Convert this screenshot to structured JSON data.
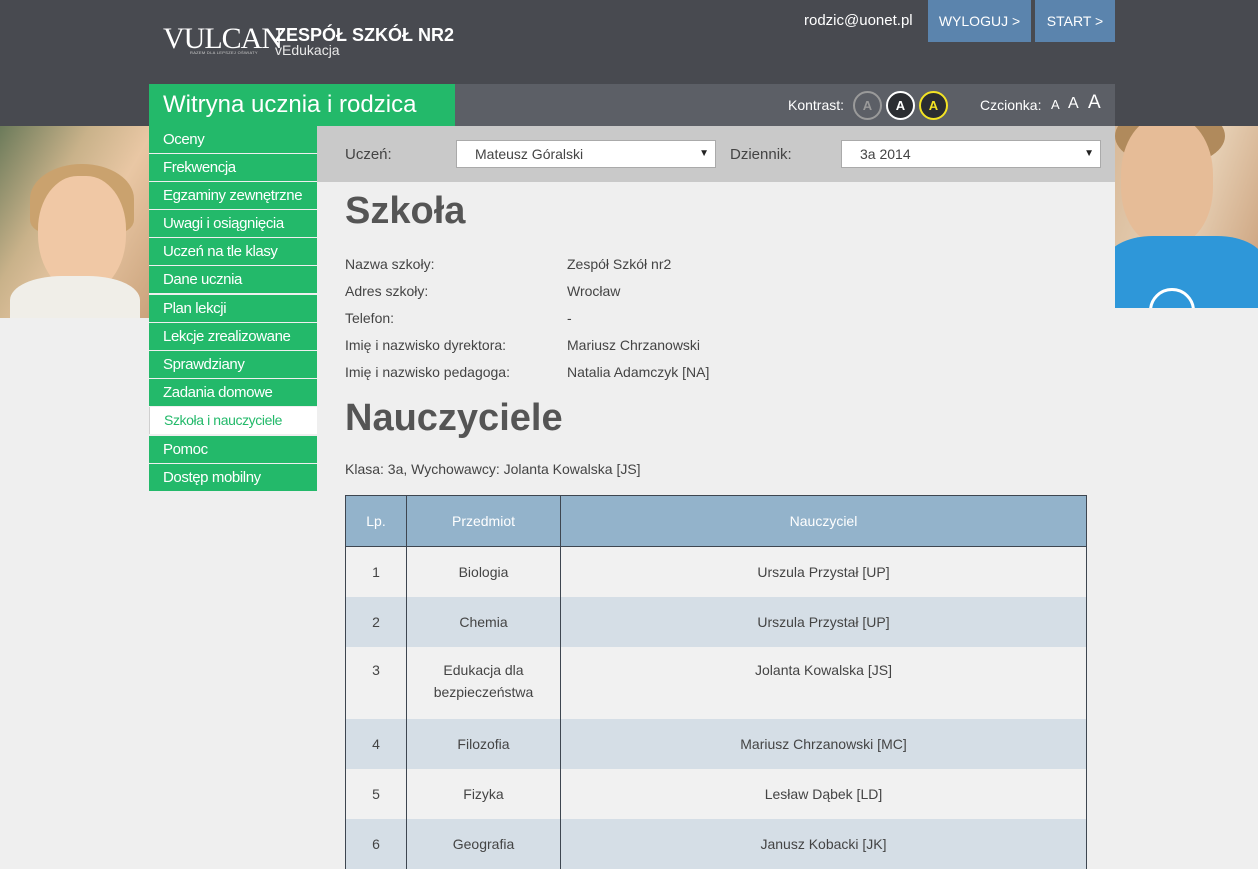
{
  "header": {
    "logo_text": "VULCAN",
    "logo_tagline": "RAZEM DLA LEPSZEJ OŚWIATY",
    "school_name": "ZESPÓŁ SZKÓŁ NR2",
    "school_sub": "vEdukacja",
    "user_email": "rodzic@uonet.pl",
    "logout_label": "WYLOGUJ >",
    "start_label": "START >"
  },
  "portal": {
    "title": "Witryna ucznia i rodzica",
    "contrast_label": "Kontrast:",
    "contrast_options": [
      "A",
      "A",
      "A"
    ],
    "font_label": "Czcionka:",
    "font_options": [
      "A",
      "A",
      "A"
    ]
  },
  "sidebar": {
    "items": [
      {
        "label": "Oceny"
      },
      {
        "label": "Frekwencja"
      },
      {
        "label": "Egzaminy zewnętrzne"
      },
      {
        "label": "Uwagi i osiągnięcia"
      },
      {
        "label": "Uczeń na tle klasy"
      },
      {
        "label": "Dane ucznia"
      },
      {
        "label": "Plan lekcji"
      },
      {
        "label": "Lekcje zrealizowane"
      },
      {
        "label": "Sprawdziany"
      },
      {
        "label": "Zadania domowe"
      },
      {
        "label": "Szkoła i nauczyciele",
        "active": true
      },
      {
        "label": "Pomoc"
      },
      {
        "label": "Dostęp mobilny"
      }
    ]
  },
  "selectors": {
    "student_label": "Uczeń:",
    "student_value": "Mateusz Góralski",
    "journal_label": "Dziennik:",
    "journal_value": "3a 2014"
  },
  "school": {
    "heading": "Szkoła",
    "fields": [
      {
        "label": "Nazwa szkoły:",
        "value": "Zespół Szkół nr2"
      },
      {
        "label": "Adres szkoły:",
        "value": "Wrocław"
      },
      {
        "label": "Telefon:",
        "value": "-"
      },
      {
        "label": "Imię i nazwisko dyrektora:",
        "value": "Mariusz Chrzanowski"
      },
      {
        "label": "Imię i nazwisko pedagoga:",
        "value": "Natalia Adamczyk [NA]"
      }
    ]
  },
  "teachers": {
    "heading": "Nauczyciele",
    "class_info": "Klasa: 3a, Wychowawcy: Jolanta Kowalska [JS]",
    "columns": [
      "Lp.",
      "Przedmiot",
      "Nauczyciel"
    ],
    "rows": [
      {
        "lp": "1",
        "subject": "Biologia",
        "teacher": "Urszula Przystał [UP]"
      },
      {
        "lp": "2",
        "subject": "Chemia",
        "teacher": "Urszula Przystał [UP]"
      },
      {
        "lp": "3",
        "subject": "Edukacja dla bezpieczeństwa",
        "teacher": "Jolanta Kowalska [JS]"
      },
      {
        "lp": "4",
        "subject": "Filozofia",
        "teacher": "Mariusz Chrzanowski [MC]"
      },
      {
        "lp": "5",
        "subject": "Fizyka",
        "teacher": "Lesław Dąbek [LD]"
      },
      {
        "lp": "6",
        "subject": "Geografia",
        "teacher": "Janusz Kobacki [JK]"
      }
    ]
  },
  "colors": {
    "brand_green": "#23b96a",
    "header_dark": "#484a50",
    "button_blue": "#5b84ad",
    "table_header": "#93b3cb",
    "row_alt": "#d5dee6"
  }
}
